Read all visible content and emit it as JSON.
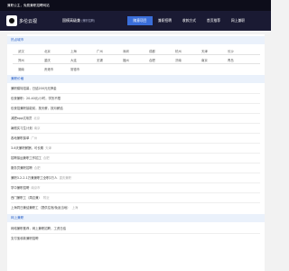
{
  "topbar": {
    "text": "兼职公主，免费兼职招聘网站"
  },
  "header": {
    "logo_text": "多伦云视",
    "brand": "国模高级兼",
    "brand_sub": "(兼职招聘)",
    "nav": [
      "随意项目",
      "兼职招聘",
      "收款方式",
      "首页推荐",
      "网上兼职"
    ],
    "active_index": 0
  },
  "cities_section": {
    "title": "热点城市",
    "rows": [
      [
        "武汉",
        "北京",
        "上海",
        "广州",
        "深圳",
        "成都",
        "杭州",
        "天津",
        "长沙"
      ],
      [
        "郑州",
        "重庆",
        "大连",
        "无锡",
        "福州",
        "合肥",
        "济南",
        "南京",
        "青岛"
      ],
      [
        "湖南",
        "贵港市",
        "常德市"
      ]
    ]
  },
  "prices_section": {
    "title": "兼职价格",
    "items": [
      {
        "text": "兼职模特招募，日结200元无押金",
        "note": ""
      },
      {
        "text": "包夜兼职：20-40元/小时，学历不限",
        "note": ""
      },
      {
        "text": "包夜招兼职接能前，按天薪，按月薪结",
        "note": ""
      },
      {
        "text": "减肥app试用员",
        "note": "北京"
      },
      {
        "text": "暑假实习生计划",
        "note": "南京"
      },
      {
        "text": "各地兼职接单",
        "note": "广州"
      },
      {
        "text": "3-6天兼职薪酬，可长期",
        "note": "天津"
      },
      {
        "text": "招聘接运兼职工作招工",
        "note": "合肥"
      },
      {
        "text": "服务员兼职招聘",
        "note": "合肥"
      },
      {
        "text": "兼职3.2-2.1万兼兼职工全职2万人",
        "note": "重庆兼职"
      },
      {
        "text": "学中兼职招聘",
        "note": "南京市"
      },
      {
        "text": "西门兼职工（周边兼）",
        "note": "附近"
      },
      {
        "text": "上海同日兼结兼职工（提供住宿/免返当地）",
        "note": "上海"
      }
    ]
  },
  "tips_section": {
    "title": "网上兼职",
    "items": [
      "网络兼职推荐，网上兼职招聘，工资日结",
      "支付宝收款兼职招聘"
    ]
  },
  "colors": {
    "topbar_bg": "#0d0d1a",
    "header_bg": "#1a1a33",
    "nav_active": "#3a6ed9",
    "section_title_bg": "#eaf1fb",
    "section_title_fg": "#2b62c9"
  }
}
